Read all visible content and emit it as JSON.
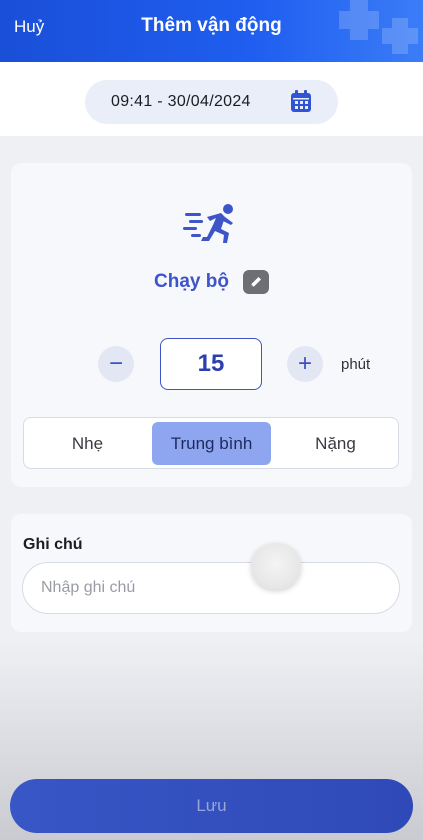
{
  "header": {
    "cancel_label": "Huỷ",
    "title": "Thêm vận động"
  },
  "datetime": {
    "value": "09:41 - 30/04/2024",
    "icon": "calendar-icon"
  },
  "activity": {
    "icon": "running-person-icon",
    "name": "Chạy bộ",
    "edit_icon": "pencil-icon",
    "duration": "15",
    "unit": "phút",
    "minus_label": "−",
    "plus_label": "+"
  },
  "intensity": {
    "options": [
      "Nhẹ",
      "Trung bình",
      "Nặng"
    ],
    "selected": "Trung bình"
  },
  "note": {
    "label": "Ghi chú",
    "placeholder": "Nhập ghi chú",
    "value": ""
  },
  "footer": {
    "save_label": "Lưu"
  },
  "colors": {
    "header_blue": "#1f5ef0",
    "accent": "#3e54c9",
    "selected_segment": "#8ea6f0"
  }
}
